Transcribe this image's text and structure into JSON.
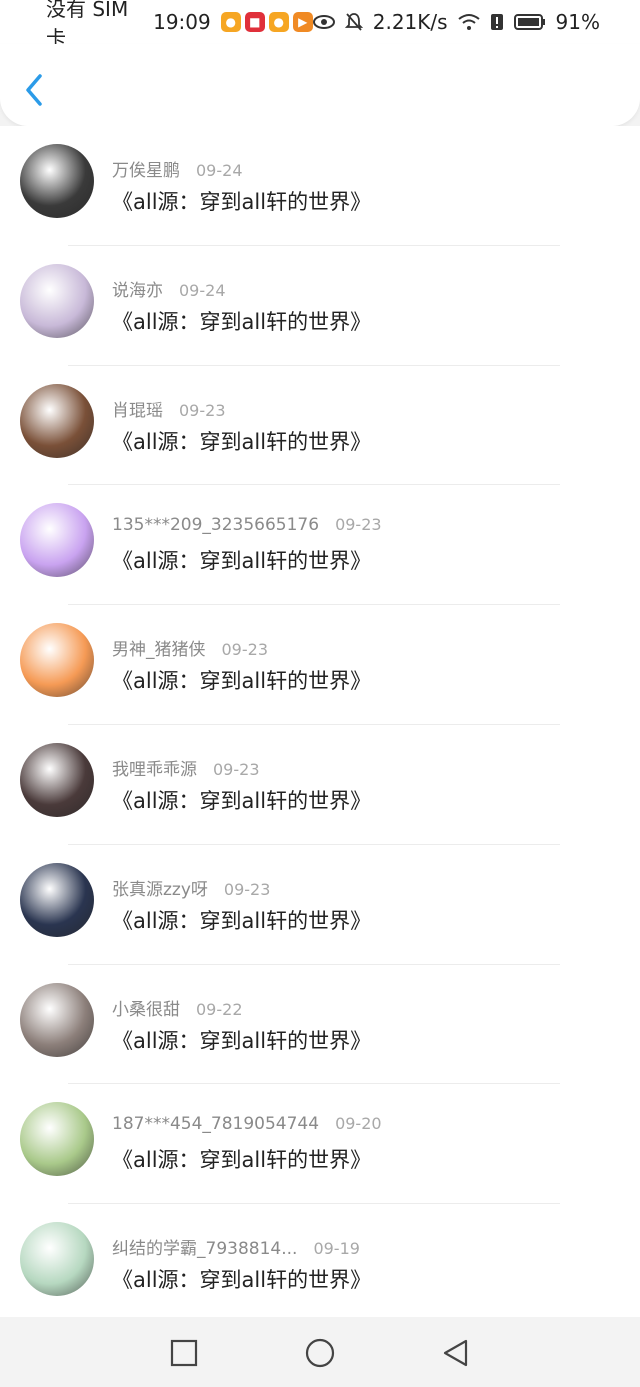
{
  "status_bar": {
    "carrier": "没有 SIM 卡",
    "time": "19:09",
    "net_speed": "2.21K/s",
    "battery": "91%"
  },
  "header": {
    "back_icon": "chevron-left-icon",
    "accent_color": "#2b9be8"
  },
  "comments": [
    {
      "user": "万俟星鹏",
      "date": "09-24",
      "title": "《all源：穿到all轩的世界》",
      "avatar_color": "#3a3a3a"
    },
    {
      "user": "说海亦",
      "date": "09-24",
      "title": "《all源：穿到all轩的世界》",
      "avatar_color": "#c8b9d8"
    },
    {
      "user": "肖琨瑶",
      "date": "09-23",
      "title": "《all源：穿到all轩的世界》",
      "avatar_color": "#7a5038"
    },
    {
      "user": "135***209_3235665176",
      "date": "09-23",
      "title": "《all源：穿到all轩的世界》",
      "avatar_color": "#c9a3f0"
    },
    {
      "user": "男神_猪猪侠",
      "date": "09-23",
      "title": "《all源：穿到all轩的世界》",
      "avatar_color": "#f59a55"
    },
    {
      "user": "我哩乖乖源",
      "date": "09-23",
      "title": "《all源：穿到all轩的世界》",
      "avatar_color": "#4a3a3a"
    },
    {
      "user": "张真源zzy呀",
      "date": "09-23",
      "title": "《all源：穿到all轩的世界》",
      "avatar_color": "#2a3550"
    },
    {
      "user": "小桑很甜",
      "date": "09-22",
      "title": "《all源：穿到all轩的世界》",
      "avatar_color": "#8c7f7a"
    },
    {
      "user": "187***454_7819054744",
      "date": "09-20",
      "title": "《all源：穿到all轩的世界》",
      "avatar_color": "#a9c98a"
    },
    {
      "user": "纠结的学霸_7938814...",
      "date": "09-19",
      "title": "《all源：穿到all轩的世界》",
      "avatar_color": "#b6d8c0"
    }
  ],
  "nav_bar": {
    "recents_icon": "square-icon",
    "home_icon": "circle-icon",
    "back_icon": "triangle-back-icon"
  }
}
